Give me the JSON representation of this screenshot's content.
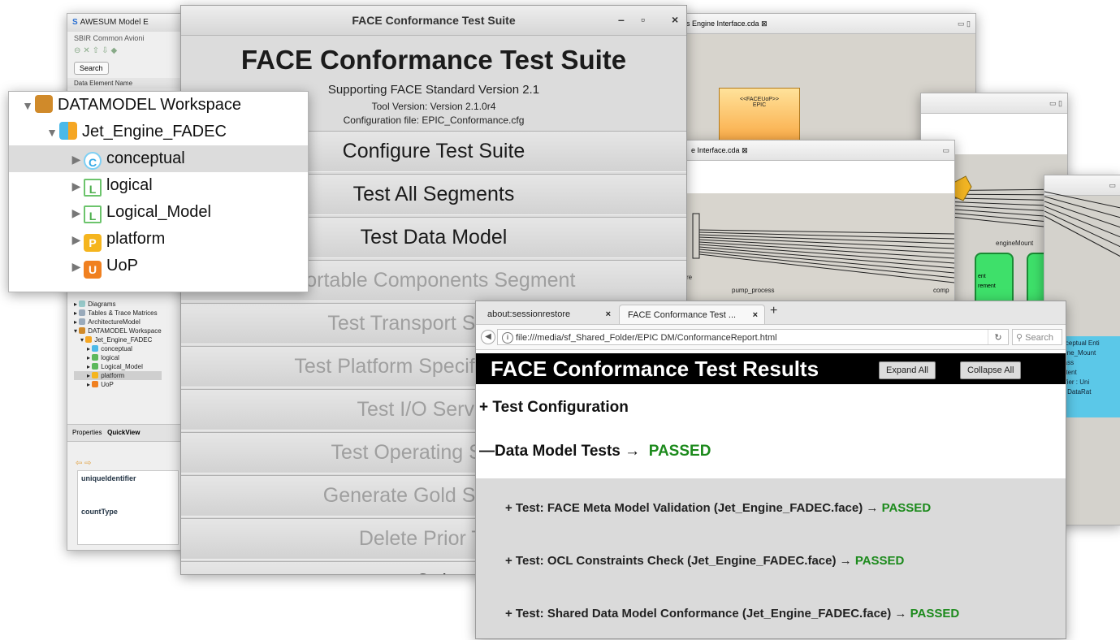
{
  "awesum": {
    "title": "AWESUM Model E",
    "subtitle": "SBIR Common Avioni",
    "search_label": "Search",
    "column_header": "Data Element Name",
    "tree": [
      "Diagrams",
      "Tables & Trace Matrices",
      "ArchitectureModel",
      "DATAMODEL Workspace",
      "Jet_Engine_FADEC",
      "conceptual",
      "logical",
      "Logical_Model",
      "platform",
      "UoP"
    ],
    "tabs": [
      "Properties",
      "QuickView"
    ],
    "fields": [
      "uniqueIdentifier",
      "countType"
    ]
  },
  "tree_zoom": {
    "workspace": "DATAMODEL Workspace",
    "project": "Jet_Engine_FADEC",
    "items": [
      "conceptual",
      "logical",
      "Logical_Model",
      "platform",
      "UoP"
    ],
    "icons": {
      "conceptual": "C",
      "logical": "L",
      "Logical_Model": "L",
      "platform": "P",
      "UoP": "U"
    }
  },
  "diagrams": {
    "tab1": "s Engine Interface.cda",
    "tab2": "e Interface.cda",
    "uop_label": "<<FACEUoP>>",
    "uop_name": "EPIC",
    "labels": [
      "engineMount",
      "pump_process",
      "ent",
      "rement",
      "re",
      "comp"
    ],
    "conceptual_box": [
      "onceptual Enti",
      "ngine_Mount",
      "Mass",
      "Extent",
      "ntifier : Uni",
      "e : DataRat"
    ]
  },
  "face": {
    "window_title": "FACE Conformance Test Suite",
    "heading": "FACE Conformance Test Suite",
    "standard": "Supporting FACE Standard Version 2.1",
    "tool_version": "Tool Version: Version 2.1.0r4",
    "config_file": "Configuration file: EPIC_Conformance.cfg",
    "minimize": "–",
    "maximize": "▫",
    "close": "×",
    "buttons": [
      {
        "label": "Configure Test Suite",
        "enabled": true
      },
      {
        "label": "Test All Segments",
        "enabled": true
      },
      {
        "label": "Test Data Model",
        "enabled": true
      },
      {
        "label": "Portable Components Segment",
        "enabled": false
      },
      {
        "label": "Test Transport Services",
        "enabled": false
      },
      {
        "label": "Test Platform Specific Services",
        "enabled": false
      },
      {
        "label": "Test I/O Services",
        "enabled": false
      },
      {
        "label": "Test Operating System",
        "enabled": false
      },
      {
        "label": "Generate Gold Standard",
        "enabled": false
      },
      {
        "label": "Delete Prior Test",
        "enabled": false
      },
      {
        "label": "Quit",
        "enabled": true
      }
    ]
  },
  "browser": {
    "tab1": "about:sessionrestore",
    "tab2": "FACE Conformance Test ...",
    "url": "file:///media/sf_Shared_Folder/EPIC DM/ConformanceReport.html",
    "search_placeholder": "Search",
    "report_title": "FACE Conformance Test Results",
    "expand_all": "Expand All",
    "collapse_all": "Collapse All",
    "test_configuration": "+ Test Configuration",
    "data_model_tests": "—Data Model Tests →",
    "data_model_status": "PASSED",
    "tests": [
      {
        "label": "+ Test: FACE Meta Model Validation (Jet_Engine_FADEC.face) →",
        "status": "PASSED"
      },
      {
        "label": "+ Test: OCL Constraints Check (Jet_Engine_FADEC.face) →",
        "status": "PASSED"
      },
      {
        "label": "+ Test: Shared Data Model Conformance (Jet_Engine_FADEC.face) →",
        "status": "PASSED"
      }
    ]
  }
}
